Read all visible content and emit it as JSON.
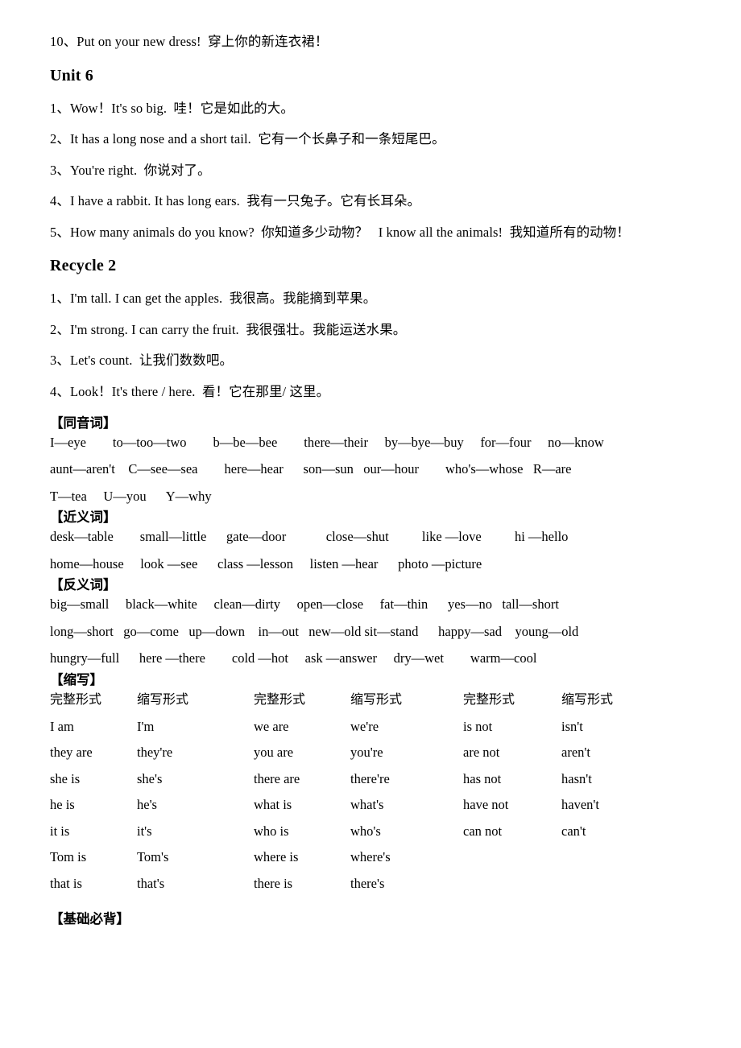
{
  "document": {
    "top_sentence": "10、Put on your new dress!  穿上你的新连衣裙！"
  },
  "unit6": {
    "heading": "Unit 6",
    "sentences": [
      "1、Wow！It's so big.  哇！它是如此的大。",
      "2、It has a long nose and a short tail.  它有一个长鼻子和一条短尾巴。",
      "3、You're right.  你说对了。",
      "4、I have a rabbit. It has long ears.  我有一只兔子。它有长耳朵。",
      "5、How many animals do you know?  你知道多少动物？   I know all the animals!  我知道所有的动物！"
    ]
  },
  "recycle2": {
    "heading": "Recycle 2",
    "sentences": [
      "1、I'm tall. I can get the apples.  我很高。我能摘到苹果。",
      "2、I'm strong. I can carry the fruit.  我很强壮。我能运送水果。",
      "3、Let's count.  让我们数数吧。",
      "4、Look！It's there / here.  看！它在那里/ 这里。"
    ]
  },
  "homophones": {
    "heading": "【同音词】",
    "rows": [
      "I—eye        to—too—two        b—be—bee        there—their     by—bye—buy     for—four     no—know",
      "aunt—aren't    C—see—sea        here—hear      son—sun   our—hour        who's—whose   R—are",
      "T—tea     U—you      Y—why"
    ]
  },
  "synonyms": {
    "heading": "【近义词】",
    "rows": [
      "desk—table        small—little      gate—door            close—shut          like —love          hi —hello",
      "home—house     look —see      class —lesson     listen —hear      photo —picture"
    ]
  },
  "antonyms": {
    "heading": "【反义词】",
    "rows": [
      "big—small     black—white     clean—dirty     open—close     fat—thin      yes—no   tall—short",
      "long—short   go—come   up—down    in—out   new—old sit—stand      happy—sad    young—old",
      "hungry—full      here —there        cold —hot     ask —answer     dry—wet        warm—cool"
    ]
  },
  "contractions": {
    "heading": "【缩写】",
    "headers": [
      "完整形式",
      "缩写形式",
      "完整形式",
      "缩写形式",
      "完整形式",
      "缩写形式"
    ],
    "rows": [
      [
        "I am",
        "I'm",
        "we are",
        "we're",
        "is not",
        "isn't"
      ],
      [
        "they are",
        "they're",
        "you are",
        "you're",
        "are not",
        "aren't"
      ],
      [
        "she is",
        "she's",
        "there are",
        "there're",
        "has not",
        "hasn't"
      ],
      [
        "he is",
        "he's",
        "what is",
        "what's",
        "have not",
        "haven't"
      ],
      [
        "it is",
        "it's",
        "who is",
        "who's",
        "can not",
        "can't"
      ],
      [
        "Tom is",
        "Tom's",
        "where is",
        "where's",
        "",
        ""
      ],
      [
        "that is",
        "that's",
        "there is",
        "there's",
        "",
        ""
      ]
    ]
  },
  "footer": {
    "heading": "【基础必背】"
  }
}
